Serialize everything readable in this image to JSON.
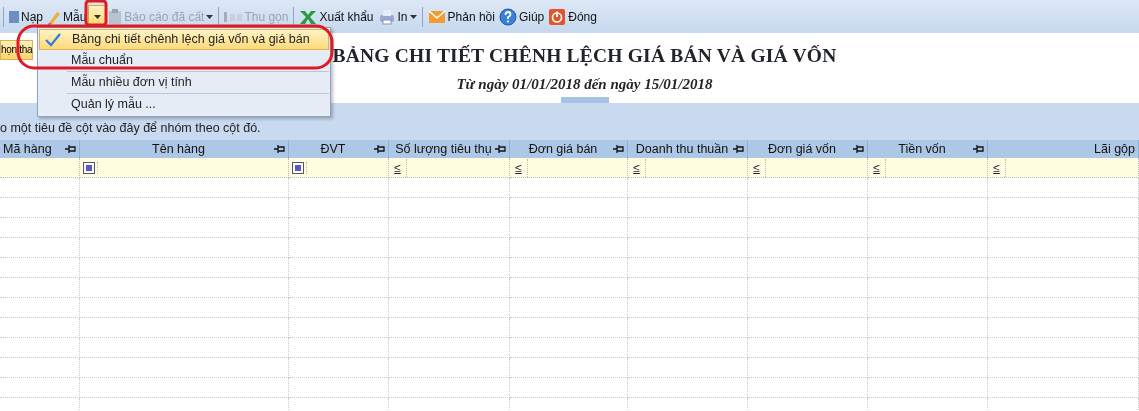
{
  "toolbar": [
    {
      "kind": "separator"
    },
    {
      "kind": "button",
      "label": "Nạp",
      "disabled": false
    },
    {
      "kind": "button",
      "label": "Mẫu",
      "disabled": false
    },
    {
      "kind": "arrow",
      "pressed": true
    },
    {
      "kind": "button",
      "label": "Báo cáo đã cất",
      "disabled": true,
      "caret": true
    },
    {
      "kind": "separator"
    },
    {
      "kind": "button",
      "label": "Thu gọn",
      "disabled": true
    },
    {
      "kind": "separator"
    },
    {
      "kind": "button",
      "label": "Xuất khẩu",
      "disabled": false
    },
    {
      "kind": "button",
      "label": "In",
      "disabled": false,
      "caret": true
    },
    {
      "kind": "separator"
    },
    {
      "kind": "button",
      "label": "Phản hồi",
      "disabled": false
    },
    {
      "kind": "button",
      "label": "Giúp",
      "disabled": false
    },
    {
      "kind": "button",
      "label": "Đóng",
      "disabled": false
    }
  ],
  "template_menu": [
    {
      "label": "Bảng chi tiết chênh lệch giá vốn và giá bán",
      "checked": true,
      "selected": true
    },
    {
      "label": "Mẫu chuẩn",
      "checked": false,
      "selected": false
    },
    {
      "label": "Mẫu nhiều đơn vị tính",
      "checked": false,
      "selected": false
    },
    {
      "label": "Quản lý mẫu ...",
      "checked": false,
      "selected": false
    }
  ],
  "report_header": {
    "side_button": "họn tha",
    "title": "BẢNG CHI TIẾT CHÊNH LỆCH GIÁ BÁN VÀ GIÁ VỐN",
    "subtitle": "Từ ngày 01/01/2018 đến ngày 15/01/2018"
  },
  "group_panel": {
    "hint": "o một tiêu đề cột vào đây để nhóm theo cột đó."
  },
  "table": {
    "columns": [
      {
        "label": "Mã hàng",
        "pinned": true
      },
      {
        "label": "Tên hàng",
        "pinned": true,
        "filter": {
          "kind": "box"
        }
      },
      {
        "label": "ĐVT",
        "pinned": true,
        "filter": {
          "kind": "box"
        }
      },
      {
        "label": "Số lượng tiêu thụ",
        "pinned": true,
        "filter": {
          "kind": "operator",
          "operator": "≤"
        }
      },
      {
        "label": "Đơn giá bán",
        "pinned": true,
        "filter": {
          "kind": "operator",
          "operator": "≤"
        }
      },
      {
        "label": "Doanh thu thuần",
        "pinned": true,
        "filter": {
          "kind": "operator",
          "operator": "≤"
        }
      },
      {
        "label": "Đơn giá vốn",
        "pinned": true,
        "filter": {
          "kind": "operator",
          "operator": "≤"
        }
      },
      {
        "label": "Tiền vốn",
        "pinned": true,
        "filter": {
          "kind": "operator",
          "operator": "≤"
        }
      },
      {
        "label": "Lãi gộp",
        "pinned": false,
        "filter": {
          "kind": "operator",
          "operator": "≤"
        }
      }
    ]
  }
}
